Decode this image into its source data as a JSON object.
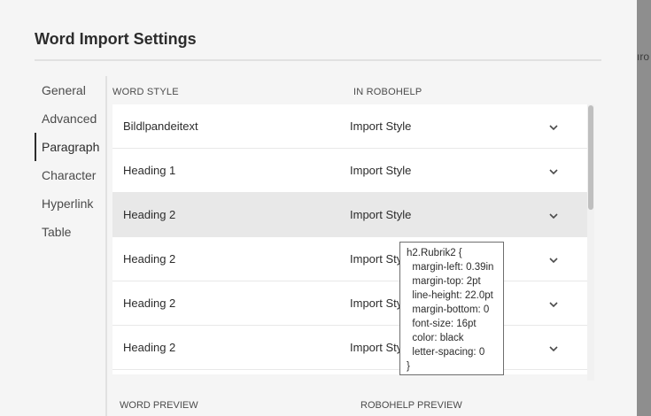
{
  "dialog": {
    "title": "Word Import Settings"
  },
  "background_text": "ıro",
  "nav": {
    "items": [
      {
        "label": "General",
        "active": false
      },
      {
        "label": "Advanced",
        "active": false
      },
      {
        "label": "Paragraph",
        "active": true
      },
      {
        "label": "Character",
        "active": false
      },
      {
        "label": "Hyperlink",
        "active": false
      },
      {
        "label": "Table",
        "active": false
      }
    ]
  },
  "table": {
    "columns": {
      "word_style": "WORD STYLE",
      "in_robohelp": "IN ROBOHELP"
    },
    "rows": [
      {
        "word_style": "Bildlpandeitext",
        "robohelp": "Import Style",
        "selected": false
      },
      {
        "word_style": "Heading 1",
        "robohelp": "Import Style",
        "selected": false
      },
      {
        "word_style": "Heading 2",
        "robohelp": "Import Style",
        "selected": true
      },
      {
        "word_style": "Heading 2",
        "robohelp": "Import Style",
        "selected": false
      },
      {
        "word_style": "Heading 2",
        "robohelp": "Import Style",
        "selected": false
      },
      {
        "word_style": "Heading 2",
        "robohelp": "Import Style",
        "selected": false
      }
    ]
  },
  "tooltip": {
    "lines": [
      "h2.Rubrik2 {",
      "  margin-left: 0.39in",
      "  margin-top: 2pt",
      "  line-height: 22.0pt",
      "  margin-bottom: 0",
      "  font-size: 16pt",
      "  color: black",
      "  letter-spacing: 0",
      "}"
    ]
  },
  "preview": {
    "word_preview": "WORD PREVIEW",
    "robohelp_preview": "ROBOHELP PREVIEW"
  },
  "colors": {
    "selected_row": "#e8e8e8",
    "accent": "#2c2c2c"
  }
}
